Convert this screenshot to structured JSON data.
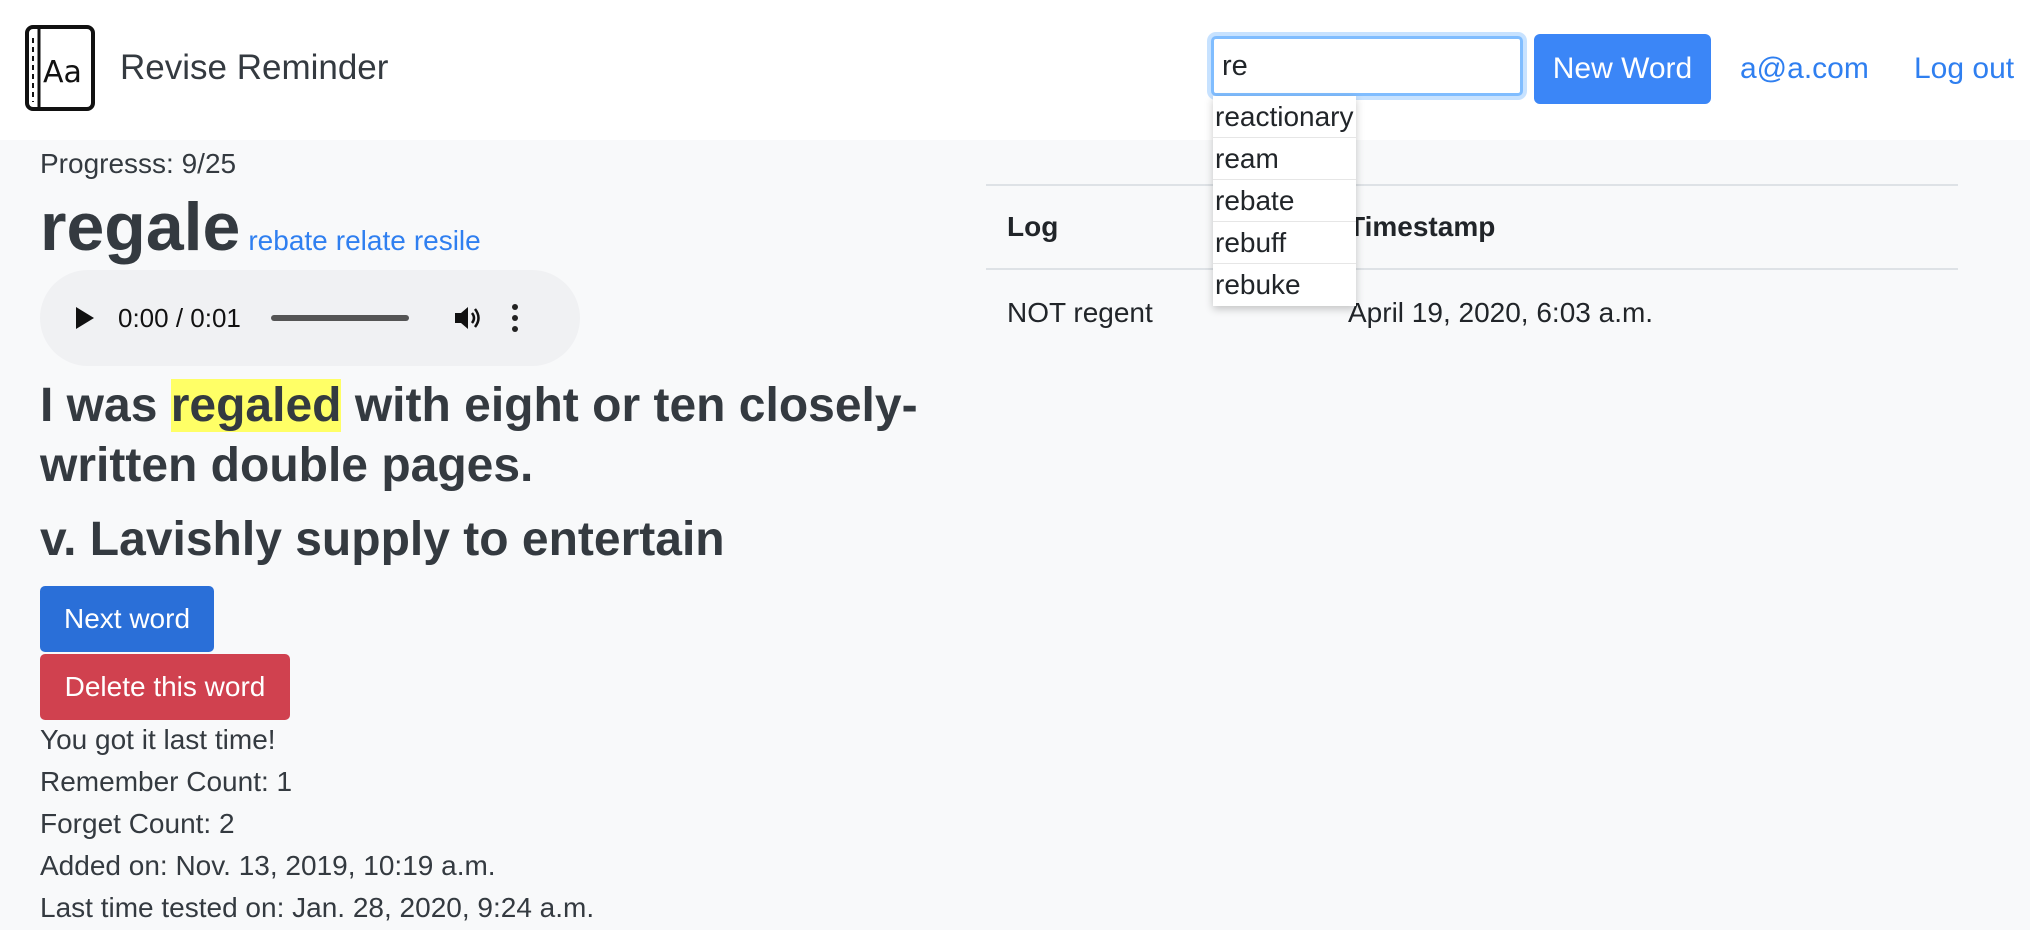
{
  "navbar": {
    "brand_name": "Revise Reminder",
    "logo_text": "Aa",
    "search_value": "re",
    "new_word_label": "New Word",
    "user_email": "a@a.com",
    "logout_label": "Log out"
  },
  "autocomplete": {
    "items": [
      "reactionary",
      "ream",
      "rebate",
      "rebuff",
      "rebuke"
    ]
  },
  "word": {
    "progress": "Progresss: 9/25",
    "title": "regale",
    "similar": [
      "rebate",
      "relate",
      "resile"
    ],
    "audio_time": "0:00 / 0:01",
    "sentence_before": "I was ",
    "sentence_highlight": "regaled",
    "sentence_after": " with eight or ten closely-written double pages.",
    "definition": "v. Lavishly supply to entertain"
  },
  "actions": {
    "next_label": "Next word",
    "delete_label": "Delete this word"
  },
  "stats": {
    "last_result": "You got it last time!",
    "remember_count": "Remember Count: 1",
    "forget_count": "Forget Count: 2",
    "added_on": "Added on: Nov. 13, 2019, 10:19 a.m.",
    "last_tested": "Last time tested on: Jan. 28, 2020, 9:24 a.m."
  },
  "log_table": {
    "headers": [
      "Log",
      "Timestamp"
    ],
    "rows": [
      {
        "log": "NOT regent",
        "timestamp": "April 19, 2020, 6:03 a.m."
      }
    ]
  },
  "colors": {
    "primary": "#3b86f7",
    "danger": "#d0414f",
    "link": "#2f7ff0",
    "highlight": "#ffff66"
  }
}
